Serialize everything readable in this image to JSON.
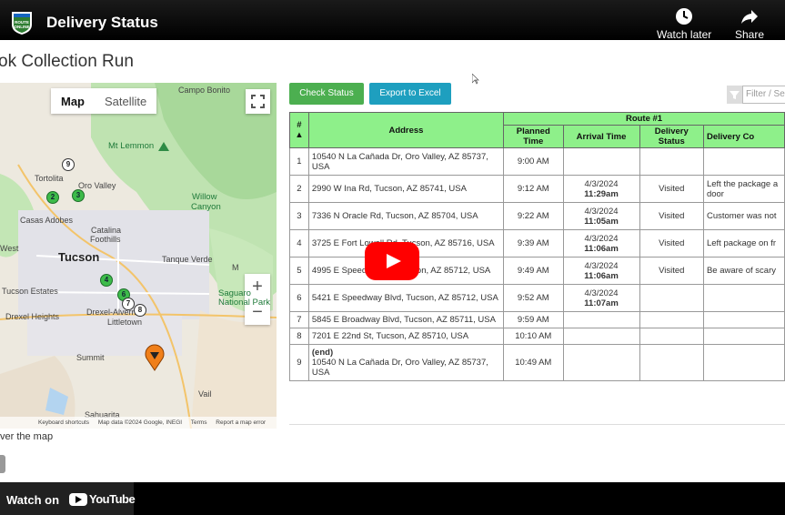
{
  "video": {
    "title": "Delivery Status",
    "channel_logo_text": "ROUTE ONLINE",
    "actions": [
      {
        "label": "Watch later",
        "icon": "clock-icon"
      },
      {
        "label": "Share",
        "icon": "share-arrow-icon"
      }
    ],
    "watch_on_label": "Watch on",
    "youtube_label": "YouTube",
    "play_icon": "play-icon",
    "brand_color": "#ff0000"
  },
  "app": {
    "page_title": "ok Collection Run",
    "buttons": {
      "check_status": "Check Status",
      "export_excel": "Export to Excel"
    },
    "filter_placeholder": "Filter / Sea",
    "map": {
      "toggle": {
        "map": "Map",
        "satellite": "Satellite",
        "selected": "Map"
      },
      "zoom_in": "+",
      "zoom_out": "−",
      "labels": {
        "campo_bonito": "Campo Bonito",
        "mt_lemmon": "Mt Lemmon",
        "tortolita": "Tortolita",
        "oro_valley": "Oro Valley",
        "willow_canyon_1": "Willow",
        "willow_canyon_2": "Canyon",
        "casas_adobes": "Casas Adobes",
        "catalina_foothills_1": "Catalina",
        "catalina_foothills_2": "Foothills",
        "west": "West",
        "tucson": "Tucson",
        "tanque_verde": "Tanque Verde",
        "saguaro_1": "Saguaro",
        "saguaro_2": "National Park",
        "tucson_estates": "Tucson Estates",
        "drexel_heights": "Drexel Heights",
        "drexel_alvernon": "Drexel-Alvernon",
        "littletown": "Littletown",
        "summit": "Summit",
        "vail": "Vail",
        "sahuarita": "Sahuarita",
        "m": "M"
      },
      "markers": [
        "9",
        "2",
        "3",
        "4",
        "6",
        "7",
        "8"
      ],
      "footer": [
        "Keyboard shortcuts",
        "Map data ©2024 Google, INEGI",
        "Terms",
        "Report a map error"
      ],
      "caption": "ver the map"
    },
    "table": {
      "route_title": "Route #1",
      "headers": {
        "num": "#",
        "sort": "▲",
        "address": "Address",
        "planned": "Planned Time",
        "arrival": "Arrival Time",
        "status": "Delivery Status",
        "comments": "Delivery Co"
      },
      "rows": [
        {
          "num": "1",
          "address": "10540 N La Cañada Dr, Oro Valley, AZ 85737, USA",
          "planned": "9:00 AM",
          "arrival_date": "",
          "arrival_time": "",
          "status": "",
          "comment": ""
        },
        {
          "num": "2",
          "address": "2990 W Ina Rd, Tucson, AZ 85741, USA",
          "planned": "9:12 AM",
          "arrival_date": "4/3/2024",
          "arrival_time": "11:29am",
          "status": "Visited",
          "comment": "Left the package a door"
        },
        {
          "num": "3",
          "address": "7336 N Oracle Rd, Tucson, AZ 85704, USA",
          "planned": "9:22 AM",
          "arrival_date": "4/3/2024",
          "arrival_time": "11:05am",
          "status": "Visited",
          "comment": "Customer was not"
        },
        {
          "num": "4",
          "address": "3725 E Fort Lowell Rd, Tucson, AZ 85716, USA",
          "planned": "9:39 AM",
          "arrival_date": "4/3/2024",
          "arrival_time": "11:06am",
          "status": "Visited",
          "comment": "Left package on fr"
        },
        {
          "num": "5",
          "address": "4995 E Speed",
          "address_tail": "ucson, AZ 85712, USA",
          "planned": "9:49 AM",
          "arrival_date": "4/3/2024",
          "arrival_time": "11:06am",
          "status": "Visited",
          "comment": "Be aware of scary"
        },
        {
          "num": "6",
          "address": "5421 E Speedway Blvd, Tucson, AZ 85712, USA",
          "planned": "9:52 AM",
          "arrival_date": "4/3/2024",
          "arrival_time": "11:07am",
          "status": "",
          "comment": ""
        },
        {
          "num": "7",
          "address": "5845 E Broadway Blvd, Tucson, AZ 85711, USA",
          "planned": "9:59 AM",
          "arrival_date": "",
          "arrival_time": "",
          "status": "",
          "comment": ""
        },
        {
          "num": "8",
          "address": "7201 E 22nd St, Tucson, AZ 85710, USA",
          "planned": "10:10 AM",
          "arrival_date": "",
          "arrival_time": "",
          "status": "",
          "comment": ""
        },
        {
          "num": "9",
          "address_prefix": "(end)",
          "address": "10540 N La Cañada Dr, Oro Valley, AZ 85737, USA",
          "planned": "10:49 AM",
          "arrival_date": "",
          "arrival_time": "",
          "status": "",
          "comment": ""
        }
      ]
    }
  }
}
